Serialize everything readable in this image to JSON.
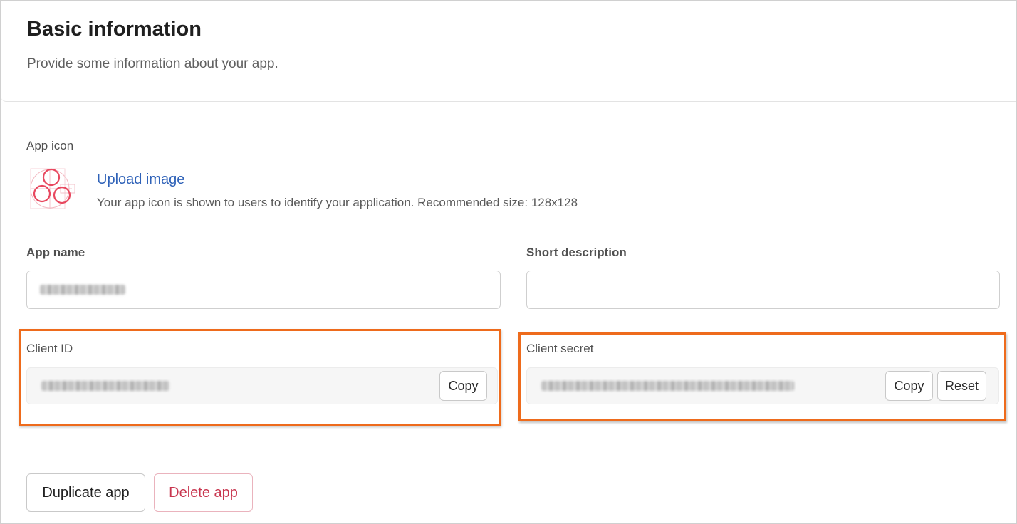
{
  "header": {
    "title": "Basic information",
    "subtitle": "Provide some information about your app."
  },
  "app_icon": {
    "label": "App icon",
    "upload_label": "Upload image",
    "help_text": "Your app icon is shown to users to identify your application. Recommended size: 128x128",
    "icon_color": "#e8485f"
  },
  "fields": {
    "app_name_label": "App name",
    "short_description_label": "Short description",
    "short_description_value": ""
  },
  "credentials": {
    "client_id_label": "Client ID",
    "client_id_copy": "Copy",
    "client_secret_label": "Client secret",
    "client_secret_copy": "Copy",
    "client_secret_reset": "Reset",
    "highlight_color": "#ee6b1c"
  },
  "actions": {
    "duplicate_label": "Duplicate app",
    "delete_label": "Delete app",
    "delete_color": "#c8364f"
  }
}
